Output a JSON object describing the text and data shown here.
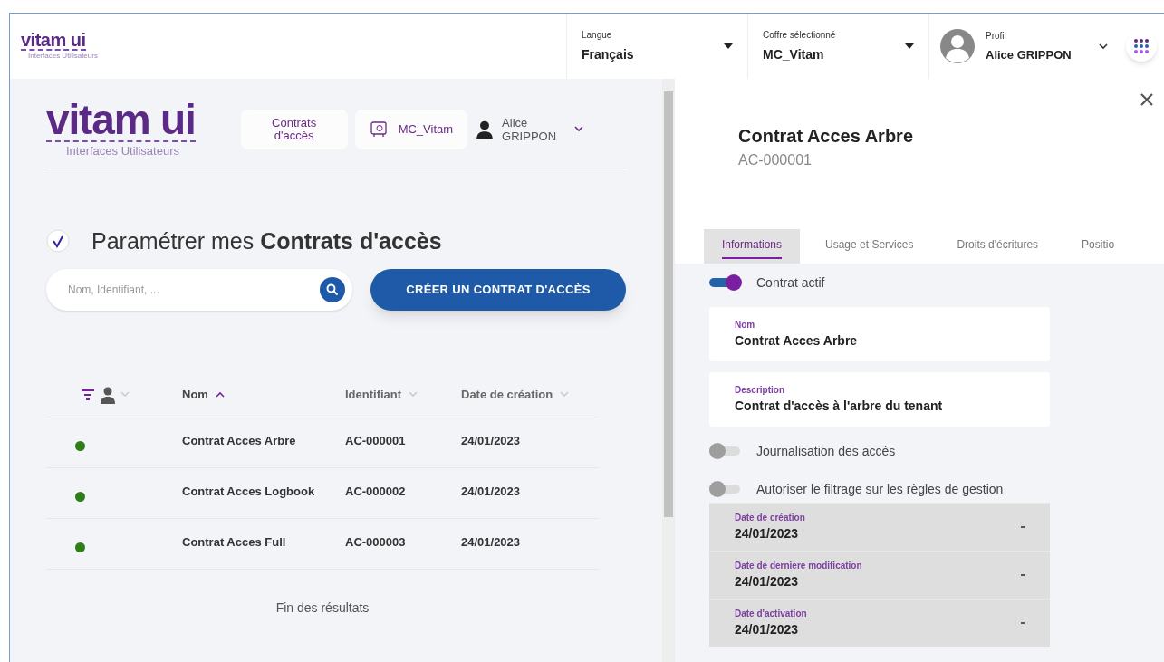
{
  "header": {
    "logo": {
      "name": "vitam ui",
      "subtitle": "Interfaces Utilisateurs"
    },
    "selectors": [
      {
        "label": "Langue",
        "value": "Français"
      },
      {
        "label": "Coffre sélectionné",
        "value": "MC_Vitam"
      }
    ],
    "profile": {
      "label": "Profil",
      "value": "Alice GRIPPON"
    }
  },
  "left": {
    "logo": {
      "name": "vitam ui",
      "subtitle": "Interfaces Utilisateurs"
    },
    "nav": {
      "app": "Contrats d'accès",
      "vault": "MC_Vitam",
      "user": "Alice GRIPPON"
    },
    "title": "Paramétrer mes **Contrats d'accès**",
    "search": {
      "placeholder": "Nom, Identifiant, ..."
    },
    "create_button": "CRÉER UN CONTRAT D'ACCÈS",
    "table": {
      "columns": [
        {
          "label": "Nom",
          "sorted": true
        },
        {
          "label": "Identifiant",
          "sorted": false
        },
        {
          "label": "Date de création",
          "sorted": false
        }
      ],
      "rows": [
        {
          "color": "#2e7d16",
          "cells": [
            "Contrat Acces Arbre",
            "AC-000001",
            "24/01/2023"
          ]
        },
        {
          "color": "#2e7d16",
          "cells": [
            "Contrat Acces Logbook",
            "AC-000002",
            "24/01/2023"
          ]
        },
        {
          "color": "#2e7d16",
          "cells": [
            "Contrat Acces Full",
            "AC-000003",
            "24/01/2023"
          ]
        }
      ]
    },
    "footer": "Fin des résultats"
  },
  "detail": {
    "title": "Contrat Acces Arbre",
    "subtitle": "AC-000001",
    "tabs": [
      {
        "label": "Informations",
        "selected": true
      },
      {
        "label": "Usage et Services",
        "selected": false
      },
      {
        "label": "Droits d'écritures",
        "selected": false
      },
      {
        "label": "Positio",
        "selected": false
      }
    ],
    "fields": [
      {
        "kind": "toggle",
        "label": "Contrat actif",
        "on": true
      },
      {
        "kind": "text",
        "label": "Nom",
        "value": "Contrat Acces Arbre"
      },
      {
        "kind": "text",
        "label": "Description",
        "value": "Contrat d'accès à l'arbre du tenant"
      },
      {
        "kind": "toggle",
        "label": "Journalisation des accès",
        "on": false
      },
      {
        "kind": "toggle",
        "label": "Autoriser le filtrage sur les règles de gestion",
        "on": false
      },
      {
        "kind": "date",
        "label": "Date de création",
        "value": "24/01/2023"
      },
      {
        "kind": "date",
        "label": "Date de derniere modification",
        "value": "24/01/2023"
      },
      {
        "kind": "date",
        "label": "Date d'activation",
        "value": "24/01/2023"
      }
    ]
  }
}
